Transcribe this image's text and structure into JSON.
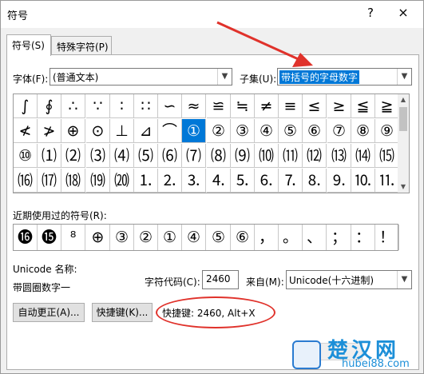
{
  "window": {
    "title": "符号",
    "help_label": "?",
    "close_label": "×"
  },
  "tabs": [
    {
      "label": "符号(S)",
      "active": true
    },
    {
      "label": "特殊字符(P)",
      "active": false
    }
  ],
  "font": {
    "label": "字体(F):",
    "value": "(普通文本)"
  },
  "subset": {
    "label": "子集(U):",
    "value": "带括号的字母数字"
  },
  "symbol_grid": {
    "rows": [
      [
        "∫",
        "∮",
        "∴",
        "∵",
        "∶",
        "∷",
        "∽",
        "≈",
        "≌",
        "≒",
        "≠",
        "≡",
        "≤",
        "≥",
        "≦",
        "≧"
      ],
      [
        "≮",
        "≯",
        "⊕",
        "⊙",
        "⊥",
        "⊿",
        "⌒",
        "①",
        "②",
        "③",
        "④",
        "⑤",
        "⑥",
        "⑦",
        "⑧",
        "⑨"
      ],
      [
        "⑩",
        "⑴",
        "⑵",
        "⑶",
        "⑷",
        "⑸",
        "⑹",
        "⑺",
        "⑻",
        "⑼",
        "⑽",
        "⑾",
        "⑿",
        "⒀",
        "⒁",
        "⒂"
      ],
      [
        "⒃",
        "⒄",
        "⒅",
        "⒆",
        "⒇",
        "⒈",
        "⒉",
        "⒊",
        "⒋",
        "⒌",
        "⒍",
        "⒎",
        "⒏",
        "⒐",
        "⒑",
        "⒒"
      ]
    ],
    "selected": "①"
  },
  "recent": {
    "label": "近期使用过的符号(R):",
    "symbols": [
      "⓰",
      "⓯",
      "⁸",
      "⊕",
      "③",
      "②",
      "①",
      "④",
      "⑤",
      "⑥",
      "，",
      "。",
      "、",
      "；",
      "：",
      "！"
    ]
  },
  "unicode_name": {
    "label": "Unicode 名称:",
    "value": "带圆圈数字一"
  },
  "char_code": {
    "label": "字符代码(C):",
    "value": "2460"
  },
  "from": {
    "label": "来自(M):",
    "value": "Unicode(十六进制)"
  },
  "buttons": {
    "autocorrect": "自动更正(A)...",
    "shortcut_key": "快捷键(K)..."
  },
  "shortcut_text": "快捷键: 2460, Alt+X",
  "watermark": {
    "text": "楚汉网",
    "url": "hubei88.com"
  },
  "colors": {
    "selection": "#0078d7",
    "annotation": "#e0322b"
  }
}
